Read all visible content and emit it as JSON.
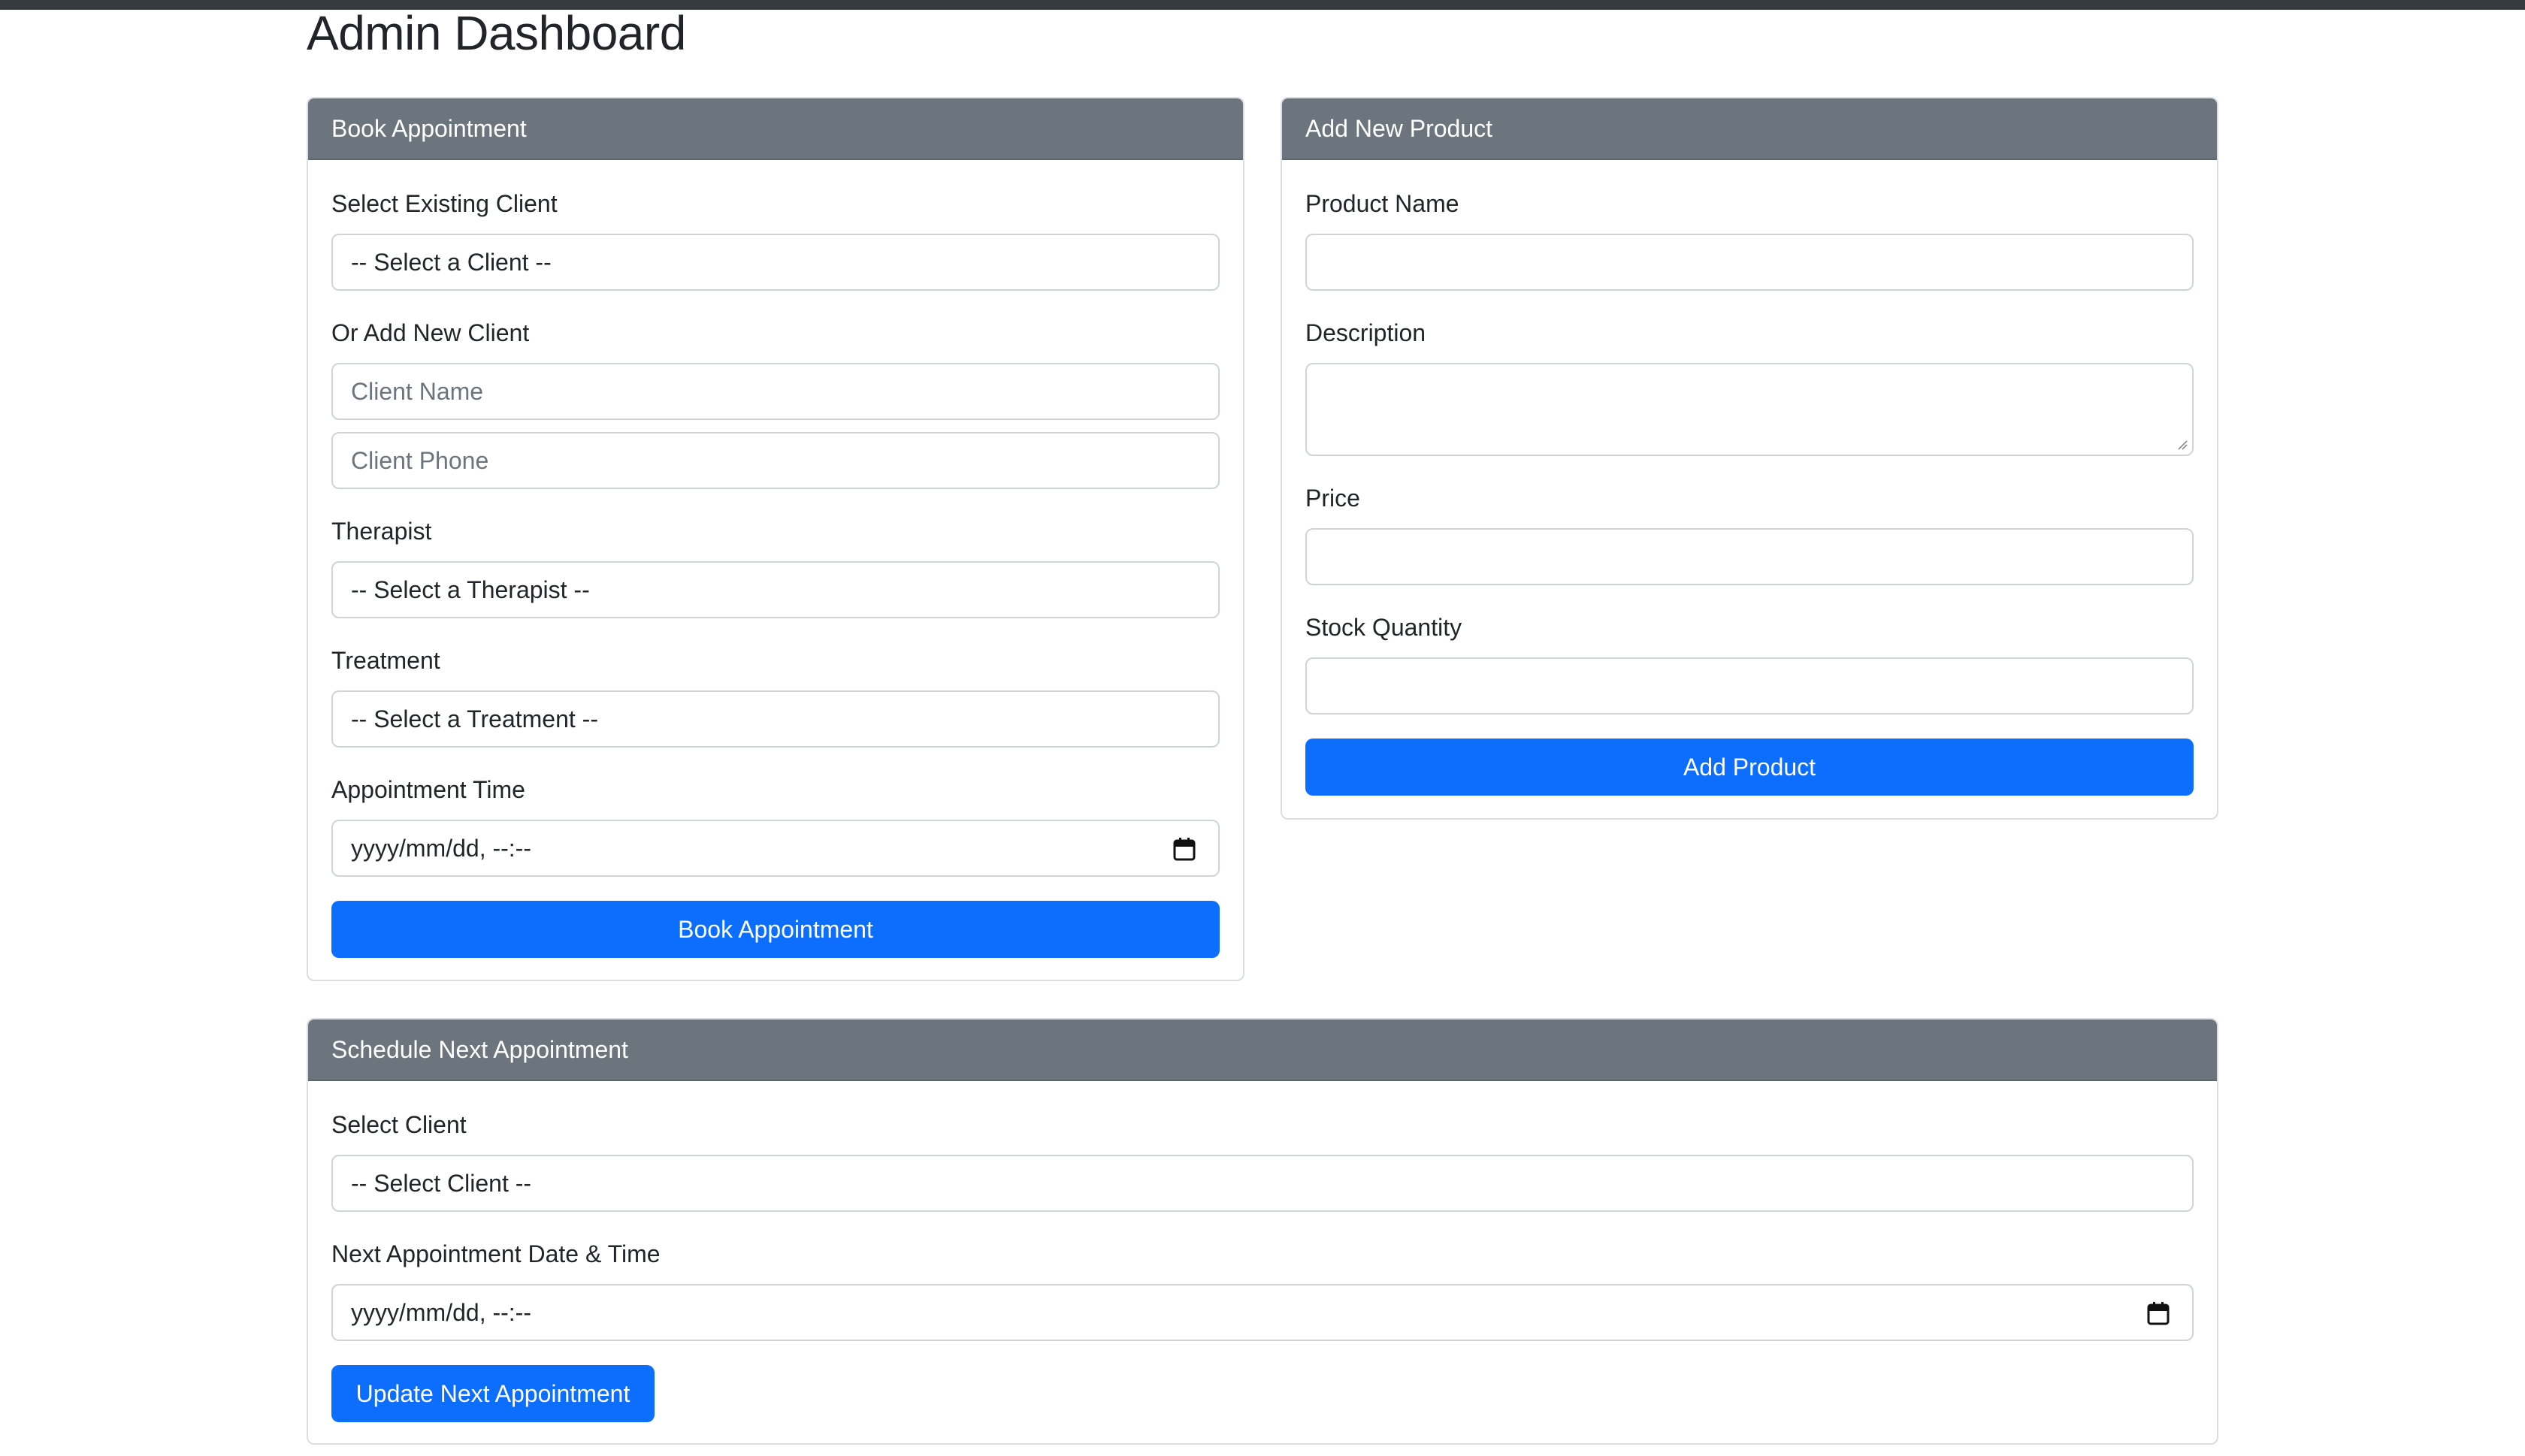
{
  "page": {
    "title": "Admin Dashboard"
  },
  "book_appointment": {
    "header": "Book Appointment",
    "existing_client_label": "Select Existing Client",
    "existing_client_selected": "-- Select a Client --",
    "new_client_label": "Or Add New Client",
    "client_name_placeholder": "Client Name",
    "client_phone_placeholder": "Client Phone",
    "therapist_label": "Therapist",
    "therapist_selected": "-- Select a Therapist --",
    "treatment_label": "Treatment",
    "treatment_selected": "-- Select a Treatment --",
    "time_label": "Appointment Time",
    "time_value": "yyyy/mm/dd, --:--",
    "submit_label": "Book Appointment"
  },
  "add_product": {
    "header": "Add New Product",
    "name_label": "Product Name",
    "description_label": "Description",
    "price_label": "Price",
    "stock_label": "Stock Quantity",
    "submit_label": "Add Product"
  },
  "next_appointment": {
    "header": "Schedule Next Appointment",
    "client_label": "Select Client",
    "client_selected": "-- Select Client --",
    "datetime_label": "Next Appointment Date & Time",
    "datetime_value": "yyyy/mm/dd, --:--",
    "submit_label": "Update Next Appointment"
  },
  "icons": {
    "datetime_picker": "calendar-icon",
    "textarea_resize": "resize-grip-icon"
  },
  "colors": {
    "card_header_bg": "#6c757d",
    "primary_button": "#0d6efd",
    "top_bar": "#343a40"
  }
}
